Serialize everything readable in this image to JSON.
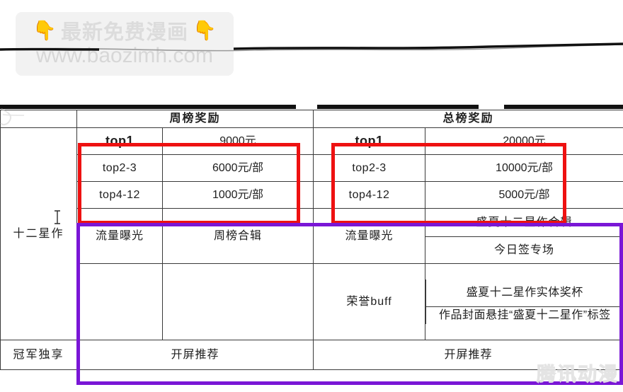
{
  "watermark": {
    "hand_left_icon": "pointing-down-hand-icon",
    "hand_right_icon": "pointing-down-hand-icon",
    "cn_text": "最新免费漫画",
    "url_text": "www.baozimh.com",
    "corner_icon": "scribble-doodle-icon",
    "site_watermark": "腾讯动漫"
  },
  "table": {
    "headers": {
      "corner": "",
      "weekly": "周榜奖励",
      "total": "总榜奖励"
    },
    "row_labels": {
      "stars": "十二星作",
      "champion": "冠军独享"
    },
    "weekly": {
      "ranks": [
        "top1",
        "top2-3",
        "top4-12"
      ],
      "prizes": [
        "9000元",
        "6000元/部",
        "1000元/部"
      ],
      "perk_label": "流量曝光",
      "perk_values": [
        "周榜合辑"
      ],
      "blank_label": "",
      "champion_value": "开屏推荐"
    },
    "total": {
      "ranks": [
        "top1",
        "top2-3",
        "top4-12"
      ],
      "prizes": [
        "20000元",
        "10000元/部",
        "5000元/部"
      ],
      "perk_label": "流量曝光",
      "perk_values": [
        "盛夏十二星作合辑",
        "今日签专场"
      ],
      "honor_label": "荣誉buff",
      "honor_values": [
        "盛夏十二星作实体奖杯",
        "作品封面悬挂“盛夏十二星作”标签"
      ],
      "champion_value": "开屏推荐"
    }
  },
  "annotations": {
    "red_color": "#ee1111",
    "purple_color": "#7a16d6",
    "red_boxes": [
      "weekly-prize-highlight",
      "total-prize-highlight"
    ],
    "purple_box": "perks-highlight"
  },
  "cursor": {
    "type": "text-ibeam"
  }
}
